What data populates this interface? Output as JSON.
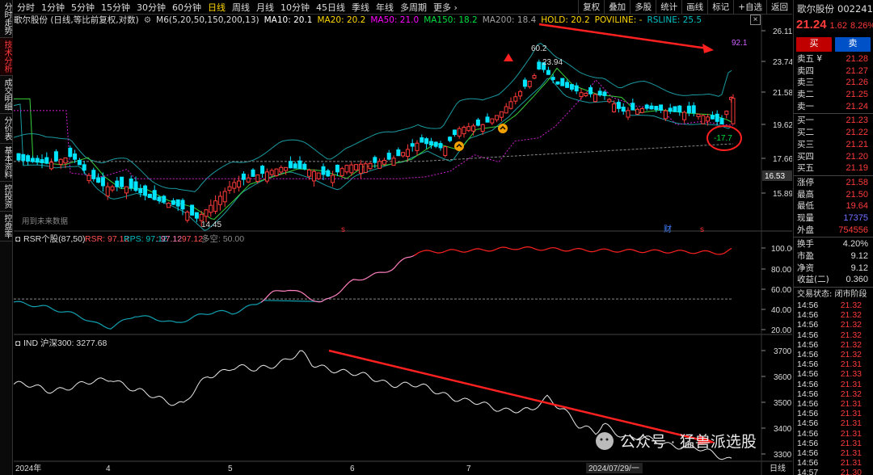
{
  "sidebar": [
    {
      "label": "分时走势"
    },
    {
      "label": "技术分析",
      "active": true
    },
    {
      "label": "成交明细"
    },
    {
      "label": "分价表"
    },
    {
      "label": "基本资料"
    },
    {
      "label": "控投资"
    },
    {
      "label": "控盘率"
    }
  ],
  "periods": [
    {
      "label": "分时"
    },
    {
      "label": "1分钟"
    },
    {
      "label": "5分钟"
    },
    {
      "label": "15分钟"
    },
    {
      "label": "30分钟"
    },
    {
      "label": "60分钟"
    },
    {
      "label": "日线",
      "active": true
    },
    {
      "label": "周线"
    },
    {
      "label": "月线"
    },
    {
      "label": "10分钟"
    },
    {
      "label": "45日线"
    },
    {
      "label": "季线"
    },
    {
      "label": "年线"
    },
    {
      "label": "多周期"
    },
    {
      "label": "更多 ›"
    }
  ],
  "tools": [
    "复权",
    "叠加",
    "多股",
    "统计",
    "画线",
    "标记",
    "+自选",
    "返回"
  ],
  "legend": {
    "title": "歌尔股份 (日线,等比前复权,对数)",
    "m6": "M6(5,20,50,150,200,13)",
    "ma10": "MA10: 20.1",
    "ma20": "MA20: 20.2",
    "ma50": "MA50: 21.0",
    "ma150": "MA150: 18.2",
    "ma200": "MA200: 18.4",
    "hold": "HOLD: 20.2",
    "poviline": "POVILINE: -",
    "rsline": "RSLINE: 25.5"
  },
  "colors": {
    "up": "#ff3b3b",
    "down": "#00e5ff",
    "ma10": "#ffffff",
    "ma20": "#ffd700",
    "ma50": "#ff00ff",
    "ma150": "#00e040",
    "ma200": "#a0a0a0",
    "hold": "#ffd700",
    "poviline": "#ffd700",
    "rsline": "#00c0c0"
  },
  "main_axis": [
    "26.11",
    "23.74",
    "21.58",
    "19.62",
    "17.66",
    "15.89"
  ],
  "main_axis_marker": "16.53",
  "annotations": {
    "high": "60.2",
    "peak": "23.94",
    "low": "14.45",
    "rsline_val": "92.1",
    "circle_val": "-17.7",
    "no_data": "用到未来数据",
    "cai": "财",
    "s_mark": "s"
  },
  "rsr": {
    "header": "RSR个股(87,50)",
    "rsr_val": "RSR: 97.12",
    "rps_val": "RPS: 97.12",
    "c3": ": 97.12",
    "c4": ": 97.12",
    "multi": "多空: 50.00",
    "axis": [
      "100.00",
      "80.00",
      "60.00",
      "40.00",
      "20.00"
    ]
  },
  "ind": {
    "header": "IND 沪深300: 3277.68",
    "axis": [
      "3700",
      "3600",
      "3500",
      "3400",
      "3300"
    ]
  },
  "xaxis": [
    "2024年",
    "4",
    "5",
    "6",
    "7",
    "2024/07/29/一",
    "日线"
  ],
  "watermark": "公众号 · 猛兽派选股",
  "right_panel": {
    "name": "歌尔股份",
    "code": "002241",
    "price": "21.24",
    "change": "1.62",
    "pct": "8.26%",
    "buy_label": "买",
    "sell_label": "卖",
    "asks": [
      {
        "k": "卖五 ¥",
        "v": "21.28"
      },
      {
        "k": "卖四",
        "v": "21.27"
      },
      {
        "k": "卖三",
        "v": "21.26"
      },
      {
        "k": "卖二",
        "v": "21.25"
      },
      {
        "k": "卖一",
        "v": "21.24"
      }
    ],
    "bids": [
      {
        "k": "买一",
        "v": "21.23"
      },
      {
        "k": "买二",
        "v": "21.22"
      },
      {
        "k": "买三",
        "v": "21.21"
      },
      {
        "k": "买四",
        "v": "21.20"
      },
      {
        "k": "买五",
        "v": "21.19"
      }
    ],
    "stats": [
      {
        "k": "涨停",
        "v": "21.58",
        "c": "red"
      },
      {
        "k": "最高",
        "v": "21.50",
        "c": "red"
      },
      {
        "k": "最低",
        "v": "19.64",
        "c": "red"
      },
      {
        "k": "现量",
        "v": "17375",
        "c": "blue"
      },
      {
        "k": "外盘",
        "v": "754556",
        "c": "red"
      }
    ],
    "stats2": [
      {
        "k": "换手",
        "v": "4.20%",
        "c": "white"
      },
      {
        "k": "市盈",
        "v": "9.12",
        "c": "white"
      },
      {
        "k": "净资",
        "v": "9.12",
        "c": "white"
      },
      {
        "k": "收益(二)",
        "v": "0.360",
        "c": "white"
      }
    ],
    "status": "交易状态: 闭市阶段",
    "trades": [
      {
        "t": "14:56",
        "p": "21.32"
      },
      {
        "t": "14:56",
        "p": "21.32"
      },
      {
        "t": "14:56",
        "p": "21.32"
      },
      {
        "t": "14:56",
        "p": "21.32"
      },
      {
        "t": "14:56",
        "p": "21.32"
      },
      {
        "t": "14:56",
        "p": "21.32"
      },
      {
        "t": "14:56",
        "p": "21.31"
      },
      {
        "t": "14:56",
        "p": "21.33"
      },
      {
        "t": "14:56",
        "p": "21.31"
      },
      {
        "t": "14:56",
        "p": "21.32"
      },
      {
        "t": "14:56",
        "p": "21.31"
      },
      {
        "t": "14:56",
        "p": "21.31"
      },
      {
        "t": "14:56",
        "p": "21.31"
      },
      {
        "t": "14:56",
        "p": "21.31"
      },
      {
        "t": "14:56",
        "p": "21.31"
      },
      {
        "t": "14:56",
        "p": "21.31"
      },
      {
        "t": "14:56",
        "p": "21.31"
      },
      {
        "t": "14:57",
        "p": "21.30"
      }
    ]
  }
}
